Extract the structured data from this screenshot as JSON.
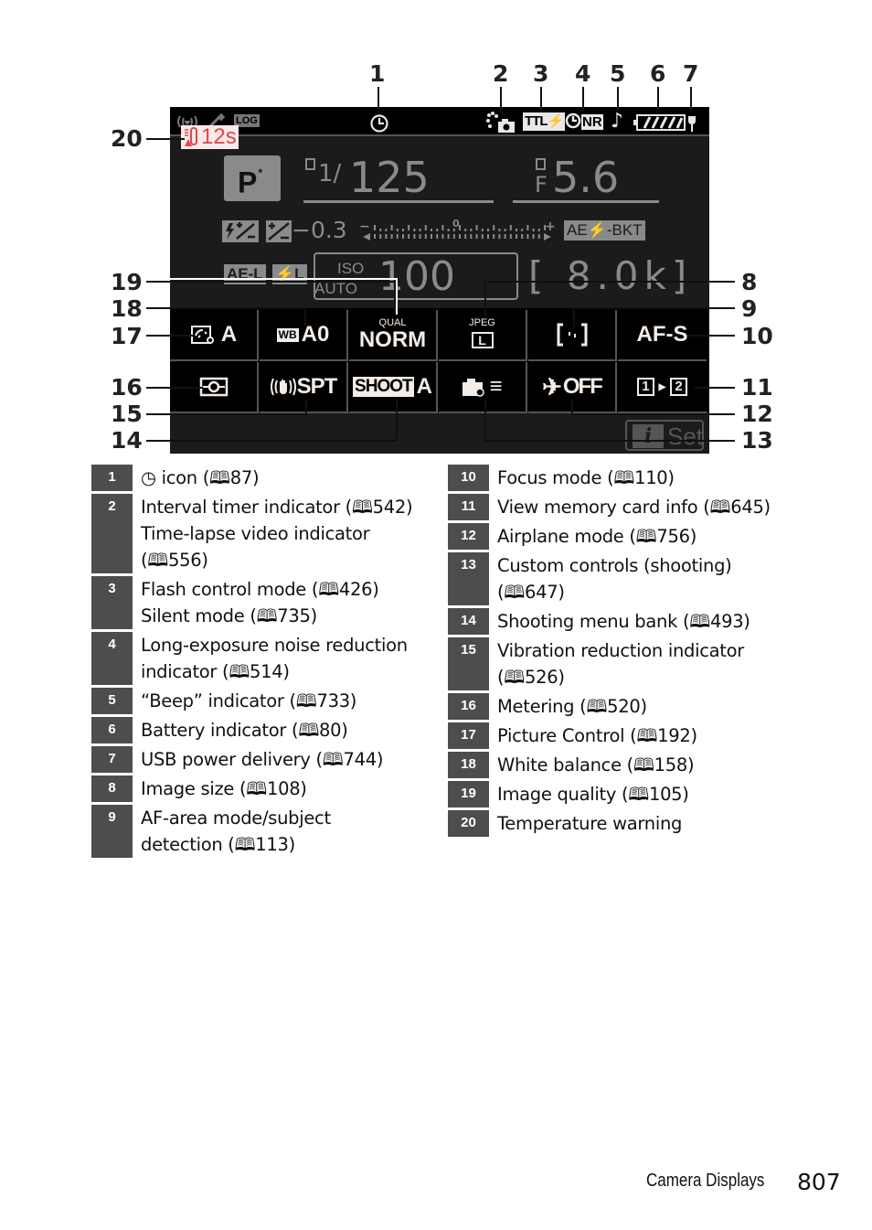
{
  "callouts": {
    "top": [
      "1",
      "2",
      "3",
      "4",
      "5",
      "6",
      "7"
    ],
    "left": [
      "20",
      "19",
      "18",
      "17",
      "16",
      "15",
      "14"
    ],
    "right": [
      "8",
      "9",
      "10",
      "11",
      "12",
      "13"
    ]
  },
  "screen": {
    "status_icons": {
      "wireless": "wireless-signal-icon",
      "gps": "satellite-icon",
      "log": "LOG",
      "self_timer": "self-timer-icon",
      "interval_timer": "interval-timer-icon",
      "flash_mode": "TTL",
      "noise_reduction": "NR",
      "beep": "♪",
      "battery": "battery-icon",
      "usb_power": "usb-power-icon"
    },
    "temperature_warning": "12s",
    "exposure_mode": "P",
    "exposure_mode_flag": "*",
    "shutter_prefix": "1/",
    "shutter_speed": "125",
    "aperture_prefix": "F",
    "aperture": "5.6",
    "flash_comp_icon": "flash-compensation-icon",
    "exp_comp_icon": "exposure-compensation-icon",
    "exposure_compensation": "−0.3",
    "meter_zero": "0",
    "meter_plus": "+",
    "meter_minus": "−",
    "bracketing": "AE⚡-BKT",
    "af_lock": "AE-L",
    "flash_lock": "⚡L",
    "iso_label_top": "ISO",
    "iso_label_bottom": "AUTO",
    "iso_value": "100",
    "frames_remaining": "[ 8.0k]",
    "imenu": {
      "picture_control": {
        "value": "A"
      },
      "white_balance": {
        "badge": "WB",
        "value": "A0"
      },
      "image_quality": {
        "label": "QUAL",
        "value": "NORM"
      },
      "image_size": {
        "label": "JPEG",
        "value": "L"
      },
      "af_area_mode": {
        "value": "[ ]"
      },
      "focus_mode": {
        "value": "AF-S"
      },
      "metering": {
        "value": "metering-icon"
      },
      "vibration_reduction": {
        "value": "SPT"
      },
      "shooting_bank": {
        "badge": "SHOOT",
        "value": "A"
      },
      "custom_controls": {
        "value": "≡"
      },
      "airplane_mode": {
        "value": "OFF"
      },
      "memory_card": {
        "slot1": "1",
        "slot2": "2"
      }
    },
    "i_button": "i",
    "set_label": "Set"
  },
  "legend_left": [
    {
      "num": "1",
      "text": "◷ icon (🕮87)"
    },
    {
      "num": "2",
      "text": "Interval timer indicator (🕮542)\nTime-lapse video indicator\n(🕮556)"
    },
    {
      "num": "3",
      "text": "Flash control mode (🕮426)\nSilent mode (🕮735)"
    },
    {
      "num": "4",
      "text": "Long-exposure noise reduction\nindicator (🕮514)"
    },
    {
      "num": "5",
      "text": "“Beep” indicator (🕮733)"
    },
    {
      "num": "6",
      "text": "Battery indicator (🕮80)"
    },
    {
      "num": "7",
      "text": "USB power delivery (🕮744)"
    },
    {
      "num": "8",
      "text": "Image size (🕮108)"
    },
    {
      "num": "9",
      "text": "AF-area mode/subject\ndetection (🕮113)"
    }
  ],
  "legend_right": [
    {
      "num": "10",
      "text": "Focus mode (🕮110)"
    },
    {
      "num": "11",
      "text": "View memory card info (🕮645)"
    },
    {
      "num": "12",
      "text": "Airplane mode (🕮756)"
    },
    {
      "num": "13",
      "text": "Custom controls (shooting)\n(🕮647)"
    },
    {
      "num": "14",
      "text": "Shooting menu bank (🕮493)"
    },
    {
      "num": "15",
      "text": "Vibration reduction indicator\n(🕮526)"
    },
    {
      "num": "16",
      "text": "Metering (🕮520)"
    },
    {
      "num": "17",
      "text": "Picture Control (🕮192)"
    },
    {
      "num": "18",
      "text": "White balance (🕮158)"
    },
    {
      "num": "19",
      "text": "Image quality (🕮105)"
    },
    {
      "num": "20",
      "text": "Temperature warning"
    }
  ],
  "footer": {
    "section": "Camera Displays",
    "page": "807"
  }
}
